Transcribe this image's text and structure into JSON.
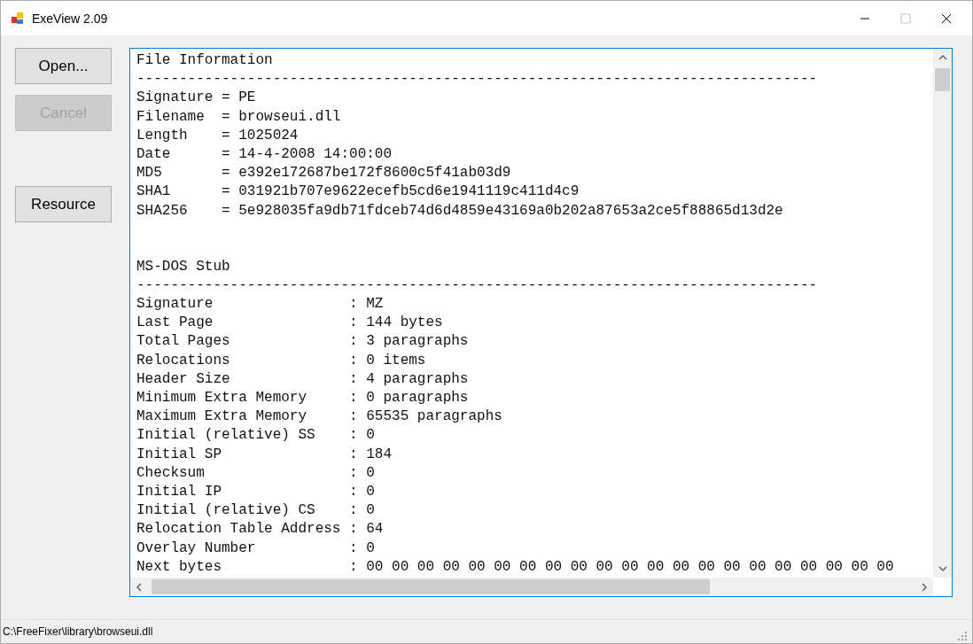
{
  "window": {
    "title": "ExeView 2.09"
  },
  "buttons": [
    {
      "label": "Open...",
      "disabled": false
    },
    {
      "label": "Cancel",
      "disabled": true
    }
  ],
  "resource_button": {
    "label": "Resource",
    "disabled": false
  },
  "sections": [
    {
      "title": "File Information",
      "rule": "--------------------------------------------------------------------------------",
      "rows": [
        "Signature = PE",
        "Filename  = browseui.dll",
        "Length    = 1025024",
        "Date      = 14-4-2008 14:00:00",
        "MD5       = e392e172687be172f8600c5f41ab03d9",
        "SHA1      = 031921b707e9622ecefb5cd6e1941119c411d4c9",
        "SHA256    = 5e928035fa9db71fdceb74d6d4859e43169a0b202a87653a2ce5f88865d13d2e"
      ]
    },
    {
      "title": "MS-DOS Stub",
      "rule": "--------------------------------------------------------------------------------",
      "rows": [
        "Signature                : MZ",
        "Last Page                : 144 bytes",
        "Total Pages              : 3 paragraphs",
        "Relocations              : 0 items",
        "Header Size              : 4 paragraphs",
        "Minimum Extra Memory     : 0 paragraphs",
        "Maximum Extra Memory     : 65535 paragraphs",
        "Initial (relative) SS    : 0",
        "Initial SP               : 184",
        "Checksum                 : 0",
        "Initial IP               : 0",
        "Initial (relative) CS    : 0",
        "Relocation Table Address : 64",
        "Overlay Number           : 0",
        "Next bytes               : 00 00 00 00 00 00 00 00 00 00 00 00 00 00 00 00 00 00 00 00 00"
      ]
    }
  ],
  "status_bar": {
    "text": "C:\\FreeFixer\\library\\browseui.dll"
  }
}
